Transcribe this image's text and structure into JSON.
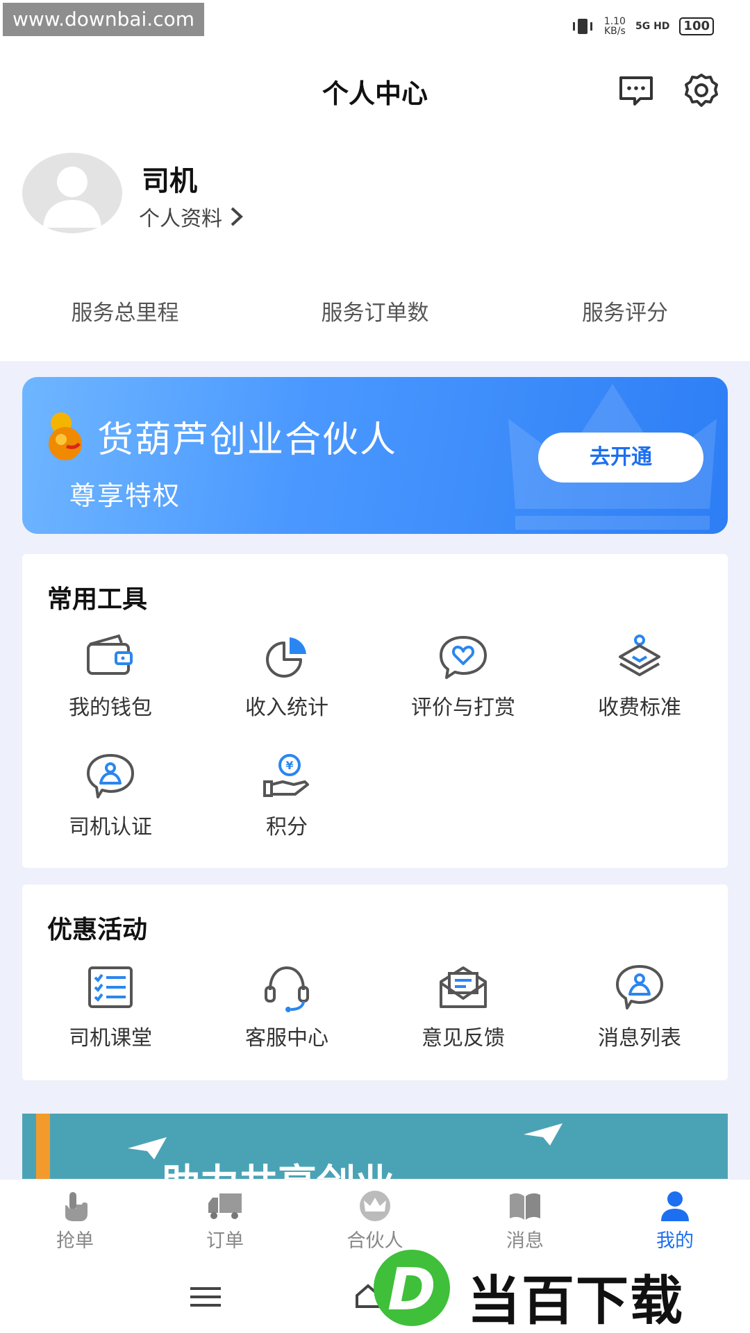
{
  "status_bar": {
    "watermark": "www.downbai.com",
    "speed_value": "1.10",
    "speed_unit": "KB/s",
    "network": "5G HD",
    "battery": "100"
  },
  "header": {
    "title": "个人中心"
  },
  "profile": {
    "name": "司机",
    "link_label": "个人资料",
    "stats": [
      "服务总里程",
      "服务订单数",
      "服务评分"
    ]
  },
  "banner": {
    "title": "货葫芦创业合伙人",
    "subtitle": "尊享特权",
    "button_label": "去开通"
  },
  "tools": {
    "title": "常用工具",
    "items": [
      {
        "label": "我的钱包",
        "icon": "wallet-icon"
      },
      {
        "label": "收入统计",
        "icon": "pie-chart-icon"
      },
      {
        "label": "评价与打赏",
        "icon": "heart-chat-icon"
      },
      {
        "label": "收费标准",
        "icon": "price-tag-icon"
      },
      {
        "label": "司机认证",
        "icon": "driver-badge-icon"
      },
      {
        "label": "积分",
        "icon": "points-hand-icon"
      }
    ]
  },
  "activities": {
    "title": "优惠活动",
    "items": [
      {
        "label": "司机课堂",
        "icon": "checklist-icon"
      },
      {
        "label": "客服中心",
        "icon": "headset-icon"
      },
      {
        "label": "意见反馈",
        "icon": "envelope-icon"
      },
      {
        "label": "消息列表",
        "icon": "message-badge-icon"
      }
    ]
  },
  "promo": {
    "text": "助力共享创业"
  },
  "tabbar": {
    "items": [
      {
        "label": "抢单",
        "icon": "tap-hand-icon"
      },
      {
        "label": "订单",
        "icon": "truck-icon"
      },
      {
        "label": "合伙人",
        "icon": "crown-icon"
      },
      {
        "label": "消息",
        "icon": "book-icon"
      },
      {
        "label": "我的",
        "icon": "user-icon"
      }
    ],
    "active_index": 4
  },
  "watermark_logo": {
    "letter": "D",
    "text": "当百下载"
  },
  "colors": {
    "accent": "#1c6ff0",
    "icon_gray": "#555555",
    "icon_blue": "#2a86f0"
  }
}
